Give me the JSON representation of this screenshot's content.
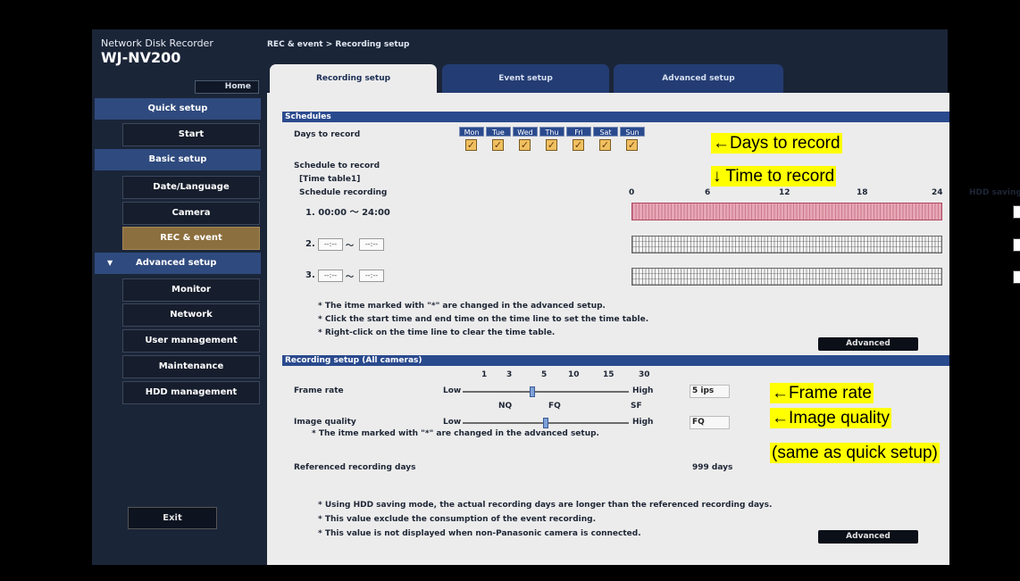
{
  "app": {
    "line1": "Network Disk Recorder",
    "line2": "WJ-NV200"
  },
  "breadcrumb": "REC & event > Recording setup",
  "home_label": "Home",
  "sidebar": {
    "quick_setup": "Quick setup",
    "start": "Start",
    "basic_setup": "Basic setup",
    "date_language": "Date/Language",
    "camera": "Camera",
    "rec_event": "REC & event",
    "advanced_setup": "Advanced setup",
    "monitor": "Monitor",
    "network": "Network",
    "user_management": "User management",
    "maintenance": "Maintenance",
    "hdd_management": "HDD management"
  },
  "exit_label": "Exit",
  "tabs": [
    "Recording setup",
    "Event setup",
    "Advanced setup"
  ],
  "schedules": {
    "header": "Schedules",
    "days_label": "Days to record",
    "days": [
      "Mon",
      "Tue",
      "Wed",
      "Thu",
      "Fri",
      "Sat",
      "Sun"
    ],
    "days_checked": [
      true,
      true,
      true,
      true,
      true,
      true,
      true
    ],
    "schedule_to_record": "Schedule to record",
    "time_table": "[Time table1]",
    "schedule_recording": "Schedule recording",
    "hour_ticks": [
      "0",
      "6",
      "12",
      "18",
      "24"
    ],
    "hdd_saving_label": "HDD saving mode",
    "row1": {
      "num": "1.",
      "start": "00:00",
      "sep": "〜",
      "end": "24:00"
    },
    "row2": {
      "num": "2.",
      "start": "--:--",
      "sep": "〜",
      "end": "--:--"
    },
    "row3": {
      "num": "3.",
      "start": "--:--",
      "sep": "〜",
      "end": "--:--"
    },
    "notes": [
      "* The itme marked with \"*\" are changed in the advanced setup.",
      "* Click the start time and end time on the time line to set the time table.",
      "* Right-click on the time line to clear the time table."
    ],
    "advanced_button": "Advanced"
  },
  "recording": {
    "header": "Recording setup (All cameras)",
    "fps_ticks": [
      "1",
      "3",
      "5",
      "10",
      "15",
      "30"
    ],
    "frame_rate_label": "Frame rate",
    "low": "Low",
    "high": "High",
    "frame_rate_value": "5 ips",
    "frame_rate_position": 0.42,
    "quality_ticks": [
      "NQ",
      "FQ",
      "SF"
    ],
    "image_quality_label": "Image quality",
    "image_quality_value": "FQ",
    "image_quality_position": 0.5,
    "note": "* The itme marked with \"*\" are changed in the advanced setup.",
    "ref_days_label": "Referenced recording days",
    "ref_days_value": "999 days",
    "notes2": [
      "* Using HDD saving mode, the actual recording days are longer than the referenced recording days.",
      "* This value exclude the consumption of the event recording.",
      "* This value is not displayed when non-Panasonic camera is connected."
    ],
    "advanced_button": "Advanced"
  },
  "annotations": {
    "days": "←Days to record",
    "time": "↓ Time to record",
    "frame": "←Frame rate",
    "quality": "←Image quality",
    "quality2": "(same as quick setup)"
  },
  "colors": {
    "accent_blue": "#2a4a8e",
    "active_item": "#8c6f3e",
    "schedule_on": "#e7a7b6",
    "highlight": "#ffff00"
  }
}
